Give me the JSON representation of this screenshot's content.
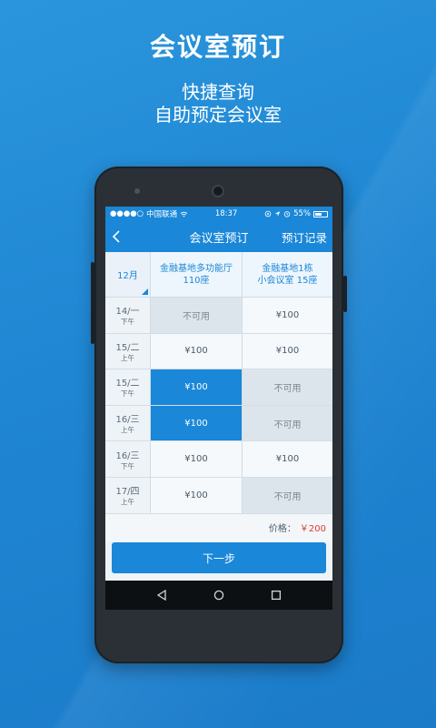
{
  "promo": {
    "title": "会议室预订",
    "subtitle_line1": "快捷查询",
    "subtitle_line2": "自助预定会议室"
  },
  "status_bar": {
    "signal": "●●●●○",
    "carrier": "中国联通",
    "time": "18:37",
    "battery": "55%"
  },
  "nav": {
    "title": "会议室预订",
    "right_action": "预订记录"
  },
  "grid": {
    "month": "12月",
    "rooms": [
      {
        "line1": "金融基地多功能厅",
        "line2": "110座"
      },
      {
        "line1": "金融基地1栋",
        "line2": "小会议室 15座"
      }
    ],
    "rows": [
      {
        "date": "14/一",
        "period": "下午",
        "slots": [
          {
            "text": "不可用",
            "state": "unavailable"
          },
          {
            "text": "¥100",
            "state": "available"
          }
        ]
      },
      {
        "date": "15/二",
        "period": "上午",
        "slots": [
          {
            "text": "¥100",
            "state": "available"
          },
          {
            "text": "¥100",
            "state": "available"
          }
        ]
      },
      {
        "date": "15/二",
        "period": "下午",
        "slots": [
          {
            "text": "¥100",
            "state": "selected"
          },
          {
            "text": "不可用",
            "state": "unavailable"
          }
        ]
      },
      {
        "date": "16/三",
        "period": "上午",
        "slots": [
          {
            "text": "¥100",
            "state": "selected"
          },
          {
            "text": "不可用",
            "state": "unavailable"
          }
        ]
      },
      {
        "date": "16/三",
        "period": "下午",
        "slots": [
          {
            "text": "¥100",
            "state": "available"
          },
          {
            "text": "¥100",
            "state": "available"
          }
        ]
      },
      {
        "date": "17/四",
        "period": "上午",
        "slots": [
          {
            "text": "¥100",
            "state": "available"
          },
          {
            "text": "不可用",
            "state": "unavailable"
          }
        ]
      }
    ]
  },
  "price": {
    "label": "价格：",
    "value": "￥200"
  },
  "next_button": "下一步",
  "colors": {
    "accent": "#1a87d8",
    "price": "#e23a2e",
    "unavailable": "#dde5ec"
  }
}
